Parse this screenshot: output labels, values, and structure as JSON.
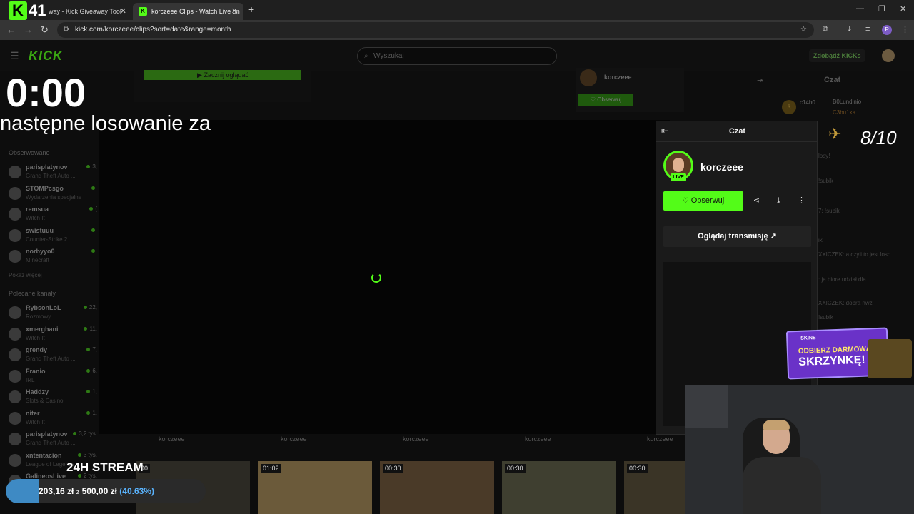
{
  "browser": {
    "tabs": [
      {
        "label": "way - Kick Giveaway Tool"
      },
      {
        "label": "korczeee Clips - Watch Live on"
      }
    ],
    "url": "kick.com/korczeee/clips?sort=date&range=month"
  },
  "overlay": {
    "badge_number": "41",
    "timer": "0:00",
    "timer_caption": "następne losowanie za",
    "score": "8/10",
    "stream_title": "24H STREAM",
    "goal": {
      "current": "203,16 zł",
      "separator": "z",
      "target": "500,00 zł",
      "percent_label": "(40.63%)",
      "progress": 0.4063
    }
  },
  "site": {
    "logo": "KICK",
    "search_placeholder": "Wyszukaj",
    "kicks_button": "Zdobądź KICKs",
    "ghost_button": "▶ Zacznij oglądać",
    "ghost_channel": "korczeee",
    "ghost_follow": "♡ Obserwuj",
    "followed_header": "Obserwowane",
    "followed": [
      {
        "name": "parisplatynov",
        "category": "Grand Theft Auto ...",
        "viewers": "3,"
      },
      {
        "name": "STOMPcsgo",
        "category": "Wydarzenia specjalne",
        "viewers": ""
      },
      {
        "name": "remsua",
        "category": "Witch It",
        "viewers": "("
      },
      {
        "name": "swistuuu",
        "category": "Counter-Strike 2",
        "viewers": ""
      },
      {
        "name": "norbyyo0",
        "category": "Minecraft",
        "viewers": ""
      }
    ],
    "show_more": "Pokaż więcej",
    "recommended_header": "Polecane kanały",
    "recommended": [
      {
        "name": "RybsonLoL",
        "category": "Rozmowy",
        "viewers": "22,"
      },
      {
        "name": "xmerghani",
        "category": "Witch It",
        "viewers": "11,"
      },
      {
        "name": "grendy",
        "category": "Grand Theft Auto ...",
        "viewers": "7,"
      },
      {
        "name": "Franio",
        "category": "IRL",
        "viewers": "6,"
      },
      {
        "name": "Haddzy",
        "category": "Slots & Casino",
        "viewers": "1,"
      },
      {
        "name": "niter",
        "category": "Witch It",
        "viewers": "1,"
      },
      {
        "name": "parisplatynov",
        "category": "Grand Theft Auto ...",
        "viewers": "3,2 tys."
      },
      {
        "name": "xntentacion",
        "category": "League of Legends",
        "viewers": "3 tys."
      },
      {
        "name": "GalineosLive",
        "category": "League of Legends",
        "viewers": "2 tys."
      }
    ],
    "clip_labels": [
      "korczeee",
      "korczeee",
      "korczeee",
      "korczeee",
      "korczeee"
    ],
    "clip_durations": [
      "00",
      "01:02",
      "00:30",
      "00:30",
      "00:30"
    ],
    "chat": {
      "title": "Czat",
      "users": [
        "c14h0",
        "B0Lundinio",
        "C3bu1ka"
      ],
      "badge": "3",
      "lines": [
        "losy!",
        "!subik",
        "7: !subik",
        "ik",
        "XXICZEK: a czyli to jest loso",
        ": ja biore udział dla",
        "XXICZEK: dobra nwz",
        "!subik"
      ]
    }
  },
  "popup": {
    "title": "Czat",
    "channel": "korczeee",
    "live": "LIVE",
    "follow": "Obserwuj",
    "watch": "Oglądaj transmisję"
  },
  "ad": {
    "brand": "SKINS",
    "line1": "ODBIERZ DARMOWĄ",
    "line2": "SKRZYNKĘ!"
  }
}
